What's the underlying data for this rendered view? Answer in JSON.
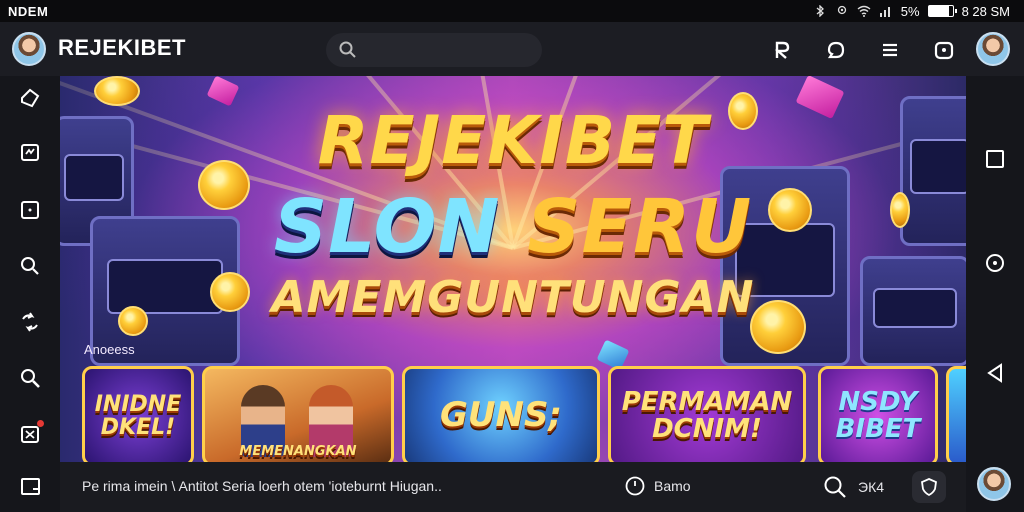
{
  "status_bar": {
    "left_text": "NDEM",
    "battery_text": "5%",
    "time": "8 28 SM",
    "battery_level": 0.85,
    "icons": [
      "bluetooth-icon",
      "location-icon",
      "wifi-icon",
      "signal-icon",
      "battery-icon"
    ]
  },
  "app_bar": {
    "brand": "REJEKIBET",
    "search_placeholder": "",
    "icons": [
      "logo-r-icon",
      "chat-icon",
      "menu-icon",
      "wallet-icon"
    ]
  },
  "left_nav": {
    "icons": [
      "home-icon",
      "games-icon",
      "video-icon",
      "search-icon",
      "transfer-icon",
      "zoom-icon",
      "gift-icon",
      "window-icon"
    ]
  },
  "right_nav": {
    "icons": [
      "square-icon",
      "location-icon",
      "back-triangle-icon"
    ]
  },
  "hero": {
    "title_line1": "REJEKIBET",
    "title_line2_word1": "SLON",
    "title_line2_word2": "SERU",
    "title_line3": "AMEMGUNTUNGAN",
    "section_label": "Anoeess"
  },
  "game_cards": [
    {
      "title": "INIDNE DKEL!"
    },
    {
      "title": "MEMENANGKAN"
    },
    {
      "title": "GUNS;"
    },
    {
      "title": "PERMAMAN DCNIM!"
    },
    {
      "title": "NSDY BIBET"
    },
    {
      "title": ""
    }
  ],
  "bottom_bar": {
    "text": "Pe rima imein \\ Antitot Seria loerh otem 'ioteburnt Hiugan..",
    "demo_label": "Bamo",
    "search_count": "ЭК4"
  },
  "colors": {
    "background": "#15161b",
    "accent_gold": "#ffd84a",
    "accent_cyan": "#7fe4ff"
  }
}
